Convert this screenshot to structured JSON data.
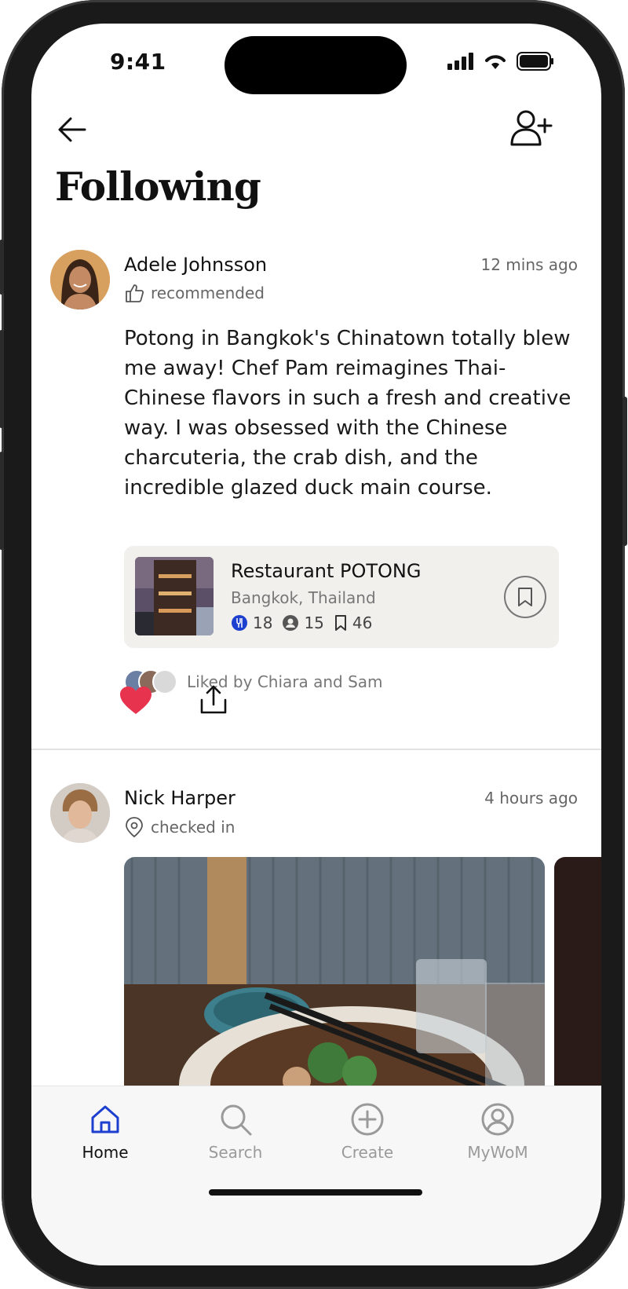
{
  "status_bar": {
    "time": "9:41"
  },
  "header": {
    "title": "Following",
    "back_icon": "arrow-left-icon",
    "add_user_icon": "user-plus-icon"
  },
  "posts": [
    {
      "author": "Adele Johnsson",
      "action": "recommended",
      "action_icon": "thumbs-up-icon",
      "time": "12 mins ago",
      "text": "Potong in Bangkok's Chinatown totally blew me away! Chef Pam reimagines Thai-Chinese flavors in such a fresh and creative way. I was obsessed with the Chinese charcuteria, the crab dish, and the incredible glazed duck main course.",
      "place": {
        "name": "Restaurant POTONG",
        "location": "Bangkok, Thailand",
        "stat_dining": "18",
        "stat_users": "15",
        "stat_saves": "46"
      },
      "liked_by": "Liked by Chiara and Sam"
    },
    {
      "author": "Nick Harper",
      "action": "checked in",
      "action_icon": "map-pin-icon",
      "time": "4 hours ago"
    }
  ],
  "tabs": [
    {
      "label": "Home",
      "active": true
    },
    {
      "label": "Search",
      "active": false
    },
    {
      "label": "Create",
      "active": false
    },
    {
      "label": "MyWoM",
      "active": false
    }
  ],
  "colors": {
    "accent": "#1d3fcf",
    "heart": "#e8334f",
    "card_bg": "#f1f0ec"
  }
}
